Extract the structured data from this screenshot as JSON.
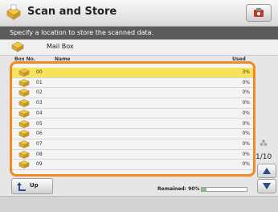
{
  "window": {
    "title": "Scan and Store"
  },
  "instruction": "Specify a location to store the scanned data.",
  "location": {
    "label": "Mail Box"
  },
  "columns": {
    "box_no": "Box No.",
    "name": "Name",
    "used": "Used"
  },
  "boxes": [
    {
      "no": "00",
      "used": "3%",
      "selected": true
    },
    {
      "no": "01",
      "used": "0%"
    },
    {
      "no": "02",
      "used": "0%"
    },
    {
      "no": "03",
      "used": "0%"
    },
    {
      "no": "04",
      "used": "0%"
    },
    {
      "no": "05",
      "used": "0%"
    },
    {
      "no": "06",
      "used": "0%"
    },
    {
      "no": "07",
      "used": "0%"
    },
    {
      "no": "08",
      "used": "0%"
    },
    {
      "no": "09",
      "used": "0%"
    }
  ],
  "pager": {
    "indicator": "1/10"
  },
  "buttons": {
    "up_label": "Up"
  },
  "remaining": {
    "label": "Remained: 90%",
    "fraction": 0.1
  },
  "colors": {
    "accent": "#f08a23",
    "selected_row": "#f6e35a"
  },
  "icons": [
    "scan-store-icon",
    "settings-icon",
    "mailbox-icon",
    "box-icon",
    "up-arrow-icon",
    "scroll-up-icon",
    "scroll-down-icon"
  ]
}
